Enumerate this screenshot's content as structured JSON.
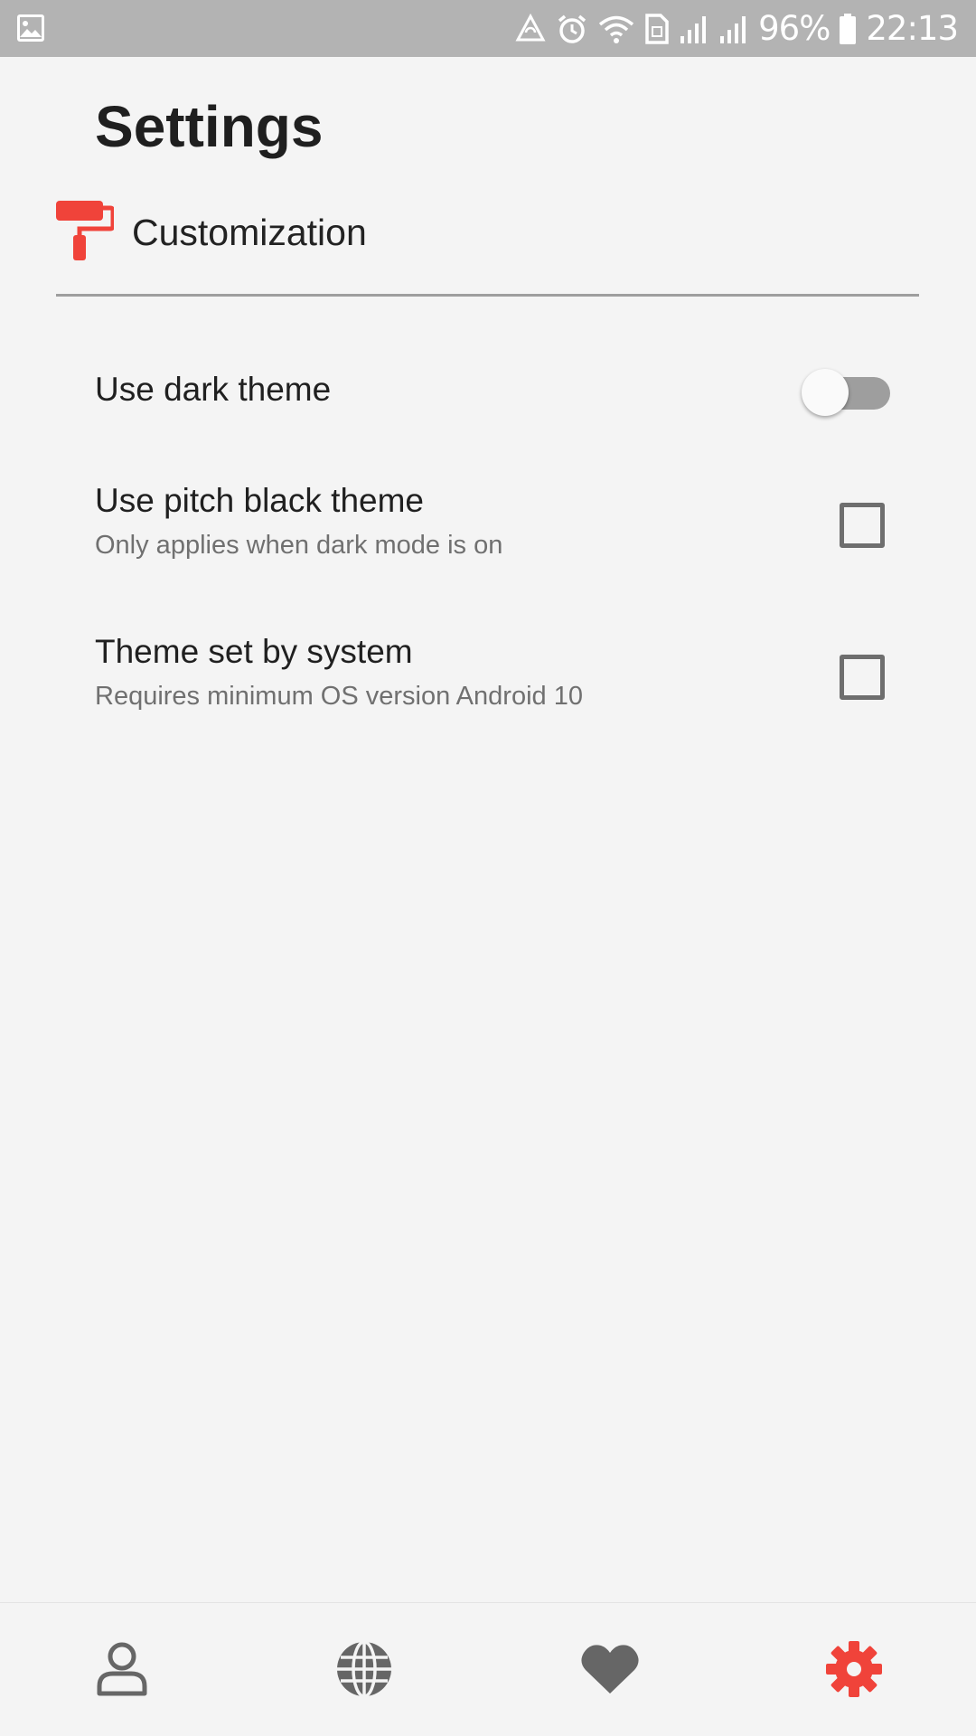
{
  "status_bar": {
    "battery": "96%",
    "time": "22:13",
    "icons": [
      "gallery-icon",
      "sync-icon",
      "alarm-icon",
      "wifi-icon",
      "sim-icon",
      "signal-icon",
      "signal-icon",
      "battery-icon"
    ]
  },
  "page": {
    "title": "Settings"
  },
  "section": {
    "label": "Customization",
    "icon": "paint-roller-icon",
    "accent_color": "#f0433a"
  },
  "settings": [
    {
      "title": "Use dark theme",
      "control": "switch",
      "checked": false
    },
    {
      "title": "Use pitch black theme",
      "subtitle": "Only applies when dark mode is on",
      "control": "checkbox",
      "checked": false
    },
    {
      "title": "Theme set by system",
      "subtitle": "Requires minimum OS version Android 10",
      "control": "checkbox",
      "checked": false
    }
  ],
  "bottom_nav": {
    "items": [
      {
        "icon": "profile-icon",
        "active": false
      },
      {
        "icon": "globe-icon",
        "active": false
      },
      {
        "icon": "heart-icon",
        "active": false
      },
      {
        "icon": "gear-icon",
        "active": true
      }
    ],
    "active_color": "#f0433a",
    "inactive_color": "#666666"
  }
}
